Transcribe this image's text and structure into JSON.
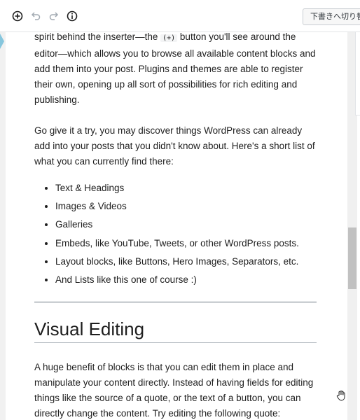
{
  "toolbar": {
    "add_block": "add-block-icon",
    "undo": "undo-icon",
    "redo": "redo-icon",
    "info": "info-icon",
    "save_draft_label": "下書きへ切り替え"
  },
  "content": {
    "para1_a": "spirit behind the inserter—the ",
    "para1_code": "(+)",
    "para1_b": " button you'll see around the editor—which allows you to browse all available content blocks and add them into your post. Plugins and themes are able to register their own, opening up all sort of possibilities for rich editing and publishing.",
    "para2": "Go give it a try, you may discover things WordPress can already add into your posts that you didn't know about. Here's a short list of what you can currently find there:",
    "list": [
      "Text & Headings",
      "Images & Videos",
      "Galleries",
      "Embeds, like YouTube, Tweets, or other WordPress posts.",
      "Layout blocks, like Buttons, Hero Images, Separators, etc.",
      "And Lists like this one of course :)"
    ],
    "heading": "Visual Editing",
    "para3": "A huge benefit of blocks is that you can edit them in place and manipulate your content directly. Instead of having fields for editing things like the source of a quote, or the text of a button, you can directly change the content. Try editing the following quote:"
  },
  "colors": {
    "text": "#1e1e1e",
    "separator": "#6c7781",
    "scroll_thumb": "#c1c1c1"
  }
}
